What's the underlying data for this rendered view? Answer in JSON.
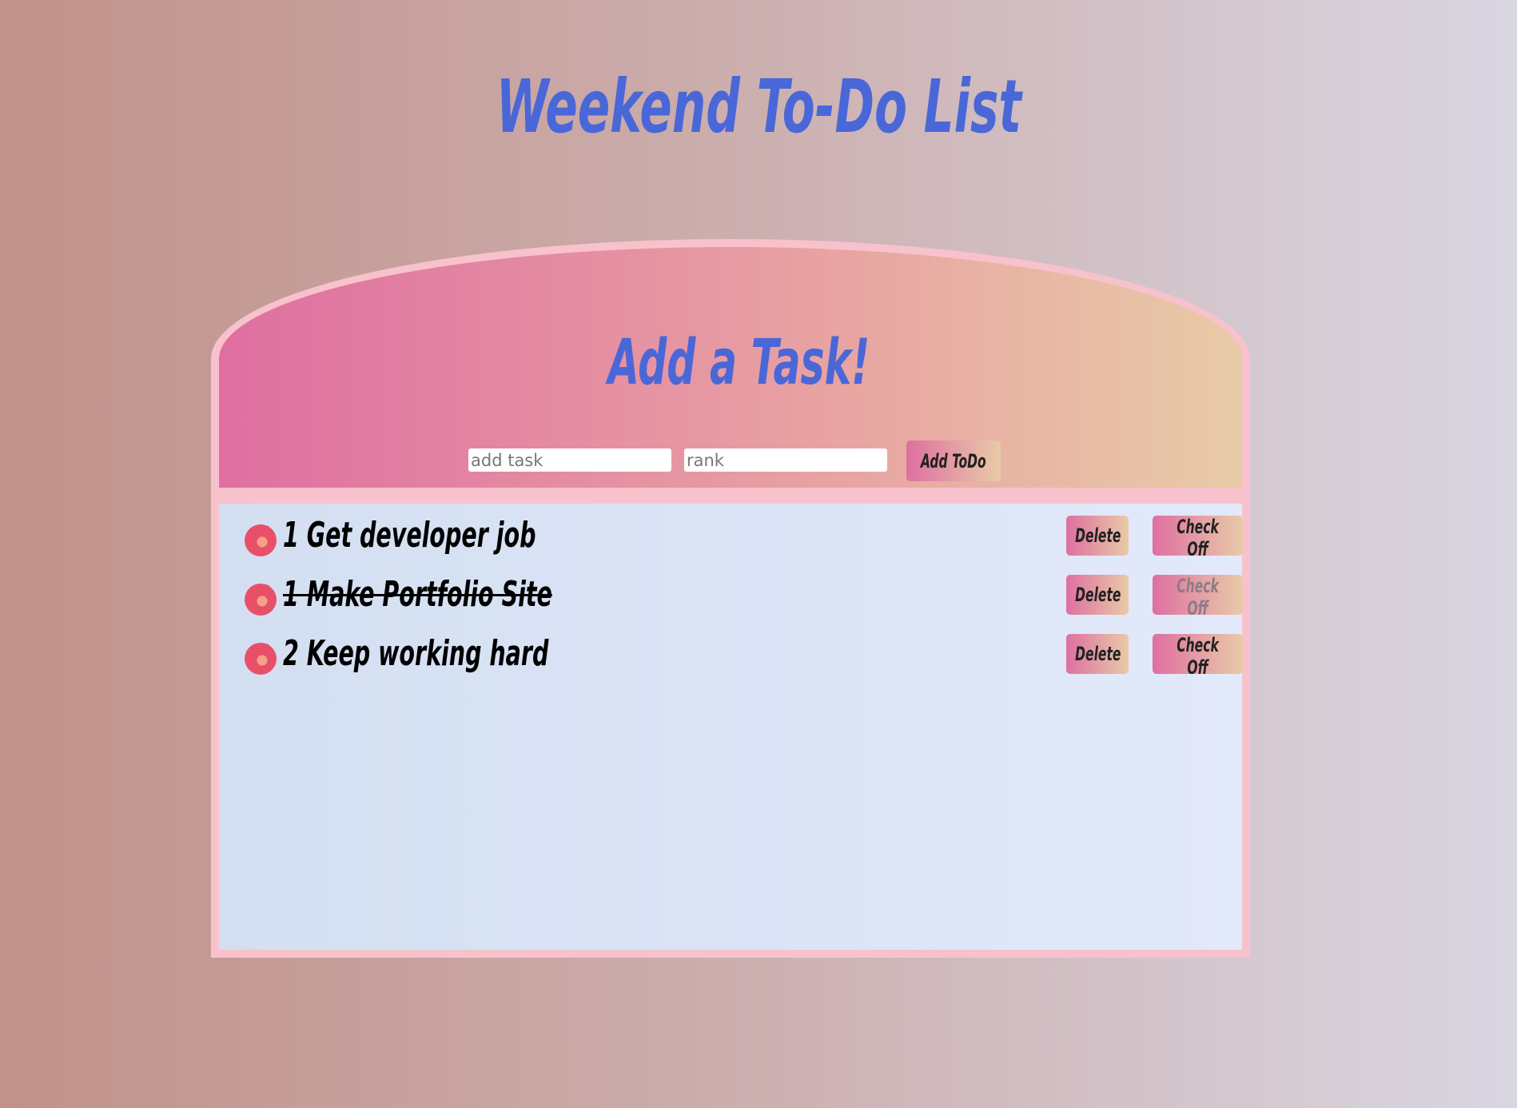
{
  "page": {
    "title": "Weekend To-Do List"
  },
  "form": {
    "heading": "Add a Task!",
    "task_placeholder": "add task",
    "rank_placeholder": "rank",
    "add_label": "Add ToDo"
  },
  "todos": [
    {
      "rank": "1",
      "text": "1 Get developer job",
      "completed": false,
      "delete_label": "Delete",
      "check_label": "Check Off"
    },
    {
      "rank": "1",
      "text": "1 Make Portfolio Site",
      "completed": true,
      "delete_label": "Delete",
      "check_label": "Check Off"
    },
    {
      "rank": "2",
      "text": "2 Keep working hard",
      "completed": false,
      "delete_label": "Delete",
      "check_label": "Check Off"
    }
  ],
  "colors": {
    "title": "#4a67d8",
    "border": "#f7c2cc",
    "gradient_start": "#df6fa1",
    "gradient_end": "#e8cba7"
  }
}
